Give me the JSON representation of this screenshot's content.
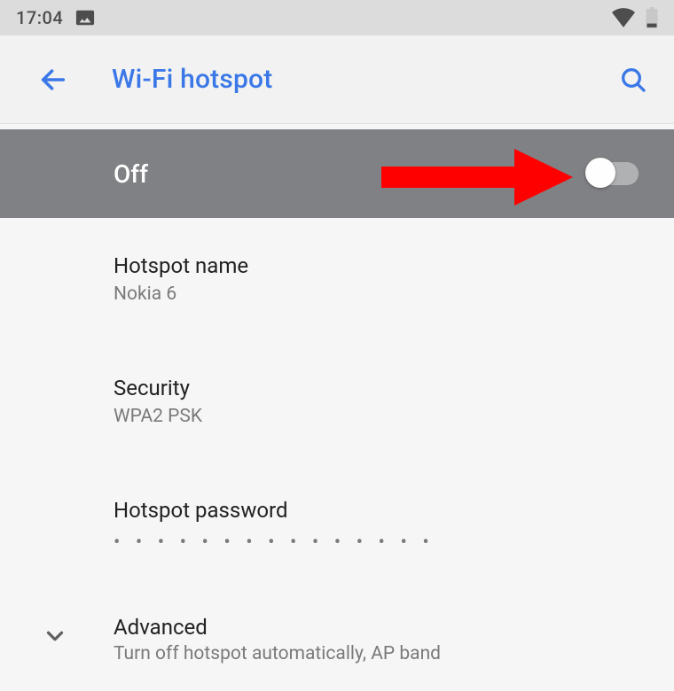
{
  "status": {
    "time": "17:04"
  },
  "header": {
    "title": "Wi-Fi hotspot"
  },
  "toggle": {
    "state_label": "Off"
  },
  "settings": {
    "hotspot_name": {
      "title": "Hotspot name",
      "value": "Nokia 6"
    },
    "security": {
      "title": "Security",
      "value": "WPA2 PSK"
    },
    "password": {
      "title": "Hotspot password",
      "dots": "• • • • • • • • • • • • • • •"
    },
    "advanced": {
      "title": "Advanced",
      "subtitle": "Turn off hotspot automatically, AP band"
    }
  },
  "colors": {
    "accent": "#3b78e7",
    "annotation": "#ff0000"
  }
}
